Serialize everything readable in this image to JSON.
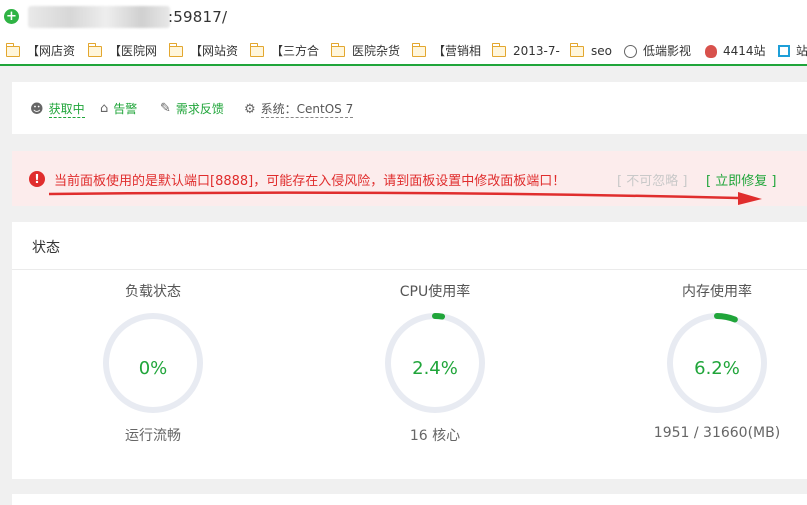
{
  "browser": {
    "url_fragment": ":59817/",
    "bookmarks": [
      {
        "label": "【网店资",
        "icon": "folder-icon"
      },
      {
        "label": "【医院网",
        "icon": "folder-icon"
      },
      {
        "label": "【网站资",
        "icon": "folder-icon"
      },
      {
        "label": "【三方合",
        "icon": "folder-icon"
      },
      {
        "label": "医院杂货",
        "icon": "folder-icon"
      },
      {
        "label": "【营销相",
        "icon": "folder-icon"
      },
      {
        "label": "2013-7-",
        "icon": "folder-icon"
      },
      {
        "label": "seo",
        "icon": "folder-icon"
      },
      {
        "label": "低端影视",
        "icon": "globe-icon"
      },
      {
        "label": "4414站",
        "icon": "site-icon"
      },
      {
        "label": "站",
        "icon": "site-icon"
      }
    ]
  },
  "nav": {
    "items": [
      {
        "label": "获取中",
        "icon": "user-icon"
      },
      {
        "label": "告警",
        "icon": "alarm-icon"
      },
      {
        "label": "需求反馈",
        "icon": "feedback-icon"
      },
      {
        "label": "系统：CentOS 7",
        "icon": "gear-icon"
      }
    ]
  },
  "alert": {
    "message": "当前面板使用的是默认端口[8888]，可能存在入侵风险，请到面板设置中修改面板端口！",
    "ignore_label": "[ 不可忽略 ]",
    "fix_label": "[ 立即修复 ]"
  },
  "status": {
    "title": "状态",
    "gauges": [
      {
        "title": "负载状态",
        "value_text": "0%",
        "percent": 0,
        "sub": "运行流畅"
      },
      {
        "title": "CPU使用率",
        "value_text": "2.4%",
        "percent": 2.4,
        "sub": "16 核心"
      },
      {
        "title": "内存使用率",
        "value_text": "6.2%",
        "percent": 6.2,
        "sub": "1951 / 31660(MB)"
      }
    ]
  },
  "colors": {
    "accent": "#20a53a",
    "alert_red": "#e02d2d",
    "alert_bg": "#fcecec",
    "ring_track": "#e8ebf2"
  }
}
